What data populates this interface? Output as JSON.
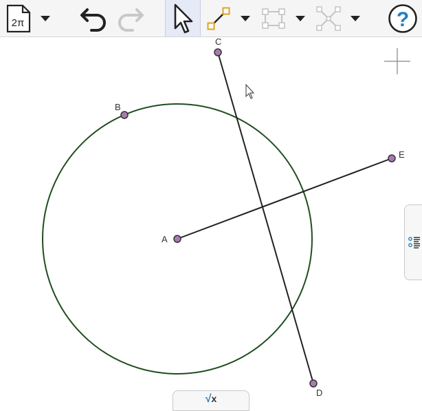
{
  "toolbar": {
    "file_icon_text": "2π",
    "help_label": "?"
  },
  "points": {
    "A": "A",
    "B": "B",
    "C": "C",
    "D": "D",
    "E": "E"
  },
  "keyboard": {
    "radical": "√",
    "variable": "x"
  },
  "colors": {
    "circle": "#1f4d1f",
    "point_fill": "#a87ab3",
    "help_icon": "#1f7fc0",
    "active_tool_bg": "#e6e9f6"
  }
}
